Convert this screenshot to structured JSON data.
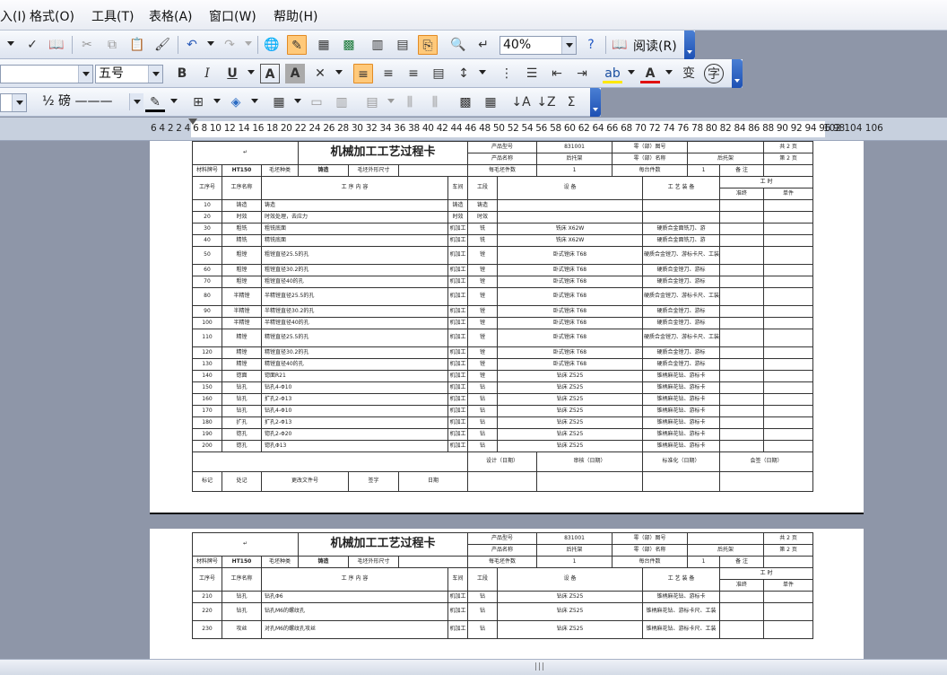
{
  "menu": {
    "insert_partial": "入(I)",
    "format": "格式(O)",
    "tools": "工具(T)",
    "table": "表格(A)",
    "window": "窗口(W)",
    "help": "帮助(H)"
  },
  "toolbar1": {
    "zoom": "40%",
    "read_label": "阅读(R)"
  },
  "toolbar2": {
    "font_size": "五号"
  },
  "toolbar3": {
    "border_weight": "½ 磅 ———"
  },
  "ruler": {
    "numbers": "6 4 2   2 4 6 8 10 12 14 16 18 20 22 24 26 28 30 32 34 36 38 40 42 44 46 48 50 52 54 56 58 60 62 64 66 68 70 72 74 76 78 80 82 84 86 88 90 92 94 96 98",
    "end_numbers": "102 104 106"
  },
  "card": {
    "title": "机械加工工艺过程卡",
    "product_model_label": "产品型号",
    "product_model": "831001",
    "part_drawing_label": "零（部）图号",
    "part_drawing": "",
    "total_label": "共",
    "total": "2",
    "total_unit": "页",
    "product_name_label": "产品名称",
    "product_name": "后托架",
    "part_name_label": "零（部）名称",
    "part_name": "后托架",
    "page_label": "第",
    "page1": "2",
    "page_unit": "页",
    "material_label": "材料牌号",
    "material": "HT150",
    "blank_type_label": "毛坯种类",
    "blank_type": "铸造",
    "blank_size_label": "毛坯外形尺寸",
    "per_blank_label": "每毛坯件数",
    "per_blank": "1",
    "per_machine_label": "每台件数",
    "per_machine": "1",
    "notes_label": "备 注",
    "hdr_step_no": "工序号",
    "hdr_step_name": "工序名称",
    "hdr_content": "工 序 内 容",
    "hdr_workshop": "车间",
    "hdr_section": "工段",
    "hdr_equipment": "设 备",
    "hdr_tooling": "工 艺 装 备",
    "hdr_time": "工 时",
    "hdr_prep": "准终",
    "hdr_unit": "单件",
    "foot_design": "设计（日期）",
    "foot_review": "审核（日期）",
    "foot_standard": "标准化（日期）",
    "foot_sign": "会签（日期）",
    "foot_mark": "标记",
    "foot_place": "处记",
    "foot_docno": "更改文件号",
    "foot_signature": "签字",
    "foot_date": "日期"
  },
  "rows": [
    {
      "no": "10",
      "name": "铸造",
      "content": "铸造",
      "ws": "铸造",
      "sec": "铸造",
      "eq": "",
      "tool": ""
    },
    {
      "no": "20",
      "name": "时效",
      "content": "时效处理，去应力",
      "ws": "时效",
      "sec": "时效",
      "eq": "",
      "tool": ""
    },
    {
      "no": "30",
      "name": "粗铣",
      "content": "粗铣底面",
      "ws": "机加工",
      "sec": "铣",
      "eq": "铣床 X62W",
      "tool": "硬质合金面铣刀、游"
    },
    {
      "no": "40",
      "name": "精铣",
      "content": "精铣底面",
      "ws": "机加工",
      "sec": "铣",
      "eq": "铣床 X62W",
      "tool": "硬质合金面铣刀、游"
    },
    {
      "no": "50",
      "name": "粗镗",
      "content": "粗镗直径25.5的孔",
      "ws": "机加工",
      "sec": "镗",
      "eq": "卧式镗床 T68",
      "tool": "硬质合金镗刀、游标卡尺、工装"
    },
    {
      "no": "60",
      "name": "粗镗",
      "content": "粗镗直径30.2的孔",
      "ws": "机加工",
      "sec": "镗",
      "eq": "卧式镗床 T68",
      "tool": "硬质合金镗刀、游标"
    },
    {
      "no": "70",
      "name": "粗镗",
      "content": "粗镗直径40的孔",
      "ws": "机加工",
      "sec": "镗",
      "eq": "卧式镗床 T68",
      "tool": "硬质合金镗刀、游标"
    },
    {
      "no": "80",
      "name": "半精镗",
      "content": "半精镗直径25.5的孔",
      "ws": "机加工",
      "sec": "镗",
      "eq": "卧式镗床 T68",
      "tool": "硬质合金镗刀、游标卡尺、工装"
    },
    {
      "no": "90",
      "name": "半精镗",
      "content": "半精镗直径30.2的孔",
      "ws": "机加工",
      "sec": "镗",
      "eq": "卧式镗床 T68",
      "tool": "硬质合金镗刀、游标"
    },
    {
      "no": "100",
      "name": "半精镗",
      "content": "半精镗直径40的孔",
      "ws": "机加工",
      "sec": "镗",
      "eq": "卧式镗床 T68",
      "tool": "硬质合金镗刀、游标"
    },
    {
      "no": "110",
      "name": "精镗",
      "content": "精镗直径25.5的孔",
      "ws": "机加工",
      "sec": "镗",
      "eq": "卧式镗床 T68",
      "tool": "硬质合金镗刀、游标卡尺、工装"
    },
    {
      "no": "120",
      "name": "精镗",
      "content": "精镗直径30.2的孔",
      "ws": "机加工",
      "sec": "镗",
      "eq": "卧式镗床 T68",
      "tool": "硬质合金镗刀、游标"
    },
    {
      "no": "130",
      "name": "精镗",
      "content": "精镗直径40的孔",
      "ws": "机加工",
      "sec": "镗",
      "eq": "卧式镗床 T68",
      "tool": "硬质合金镗刀、游标"
    },
    {
      "no": "140",
      "name": "锪面",
      "content": "锪面R21",
      "ws": "机加工",
      "sec": "镗",
      "eq": "钻床 Z525",
      "tool": "锥柄麻花钻、游标卡"
    },
    {
      "no": "150",
      "name": "钻孔",
      "content": "钻孔4-Φ10",
      "ws": "机加工",
      "sec": "钻",
      "eq": "钻床 Z525",
      "tool": "锥柄麻花钻、游标卡"
    },
    {
      "no": "160",
      "name": "钻孔",
      "content": "扩孔2-Φ13",
      "ws": "机加工",
      "sec": "钻",
      "eq": "钻床 Z525",
      "tool": "锥柄麻花钻、游标卡"
    },
    {
      "no": "170",
      "name": "钻孔",
      "content": "钻孔4-Φ10",
      "ws": "机加工",
      "sec": "钻",
      "eq": "钻床 Z525",
      "tool": "锥柄麻花钻、游标卡"
    },
    {
      "no": "180",
      "name": "扩孔",
      "content": "扩孔2-Φ13",
      "ws": "机加工",
      "sec": "钻",
      "eq": "钻床 Z525",
      "tool": "锥柄麻花钻、游标卡"
    },
    {
      "no": "190",
      "name": "锪孔",
      "content": "锪孔2-Φ20",
      "ws": "机加工",
      "sec": "钻",
      "eq": "钻床 Z525",
      "tool": "锥柄麻花钻、游标卡"
    },
    {
      "no": "200",
      "name": "锪孔",
      "content": "锪孔Φ13",
      "ws": "机加工",
      "sec": "钻",
      "eq": "钻床 Z525",
      "tool": "锥柄麻花钻、游标卡"
    }
  ],
  "rows2": [
    {
      "no": "210",
      "name": "钻孔",
      "content": "钻孔Φ6",
      "ws": "机加工",
      "sec": "钻",
      "eq": "钻床 Z525",
      "tool": "锥柄麻花钻、游标卡"
    },
    {
      "no": "220",
      "name": "钻孔",
      "content": "钻孔M6的螺纹孔",
      "ws": "机加工",
      "sec": "钻",
      "eq": "钻床 Z525",
      "tool": "锥柄麻花钻、游标卡尺、工装"
    },
    {
      "no": "230",
      "name": "攻丝",
      "content": "对孔M6的螺纹孔攻丝",
      "ws": "机加工",
      "sec": "钻",
      "eq": "钻床 Z525",
      "tool": "锥柄麻花钻、游标卡尺、工装"
    }
  ]
}
